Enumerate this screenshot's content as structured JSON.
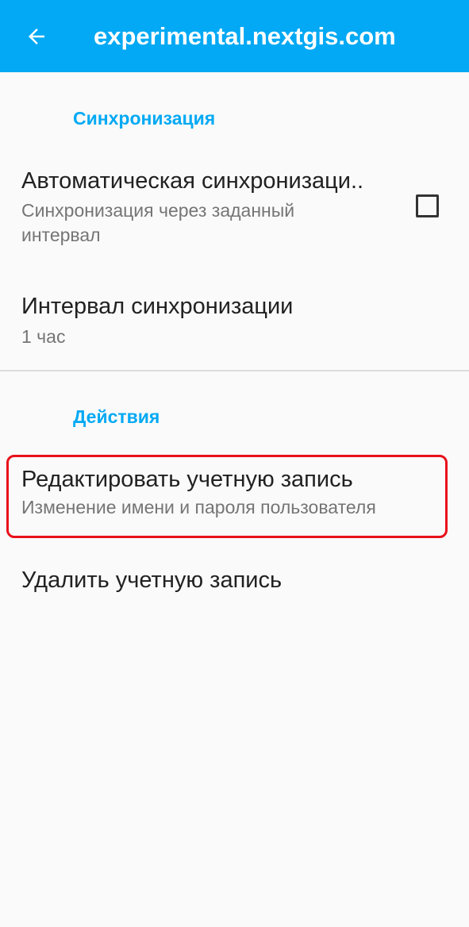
{
  "appbar": {
    "title": "experimental.nextgis.com",
    "back_icon": "arrow-back-icon",
    "background_color": "#03a9f4"
  },
  "sections": {
    "sync": {
      "header": "Синхронизация",
      "auto_sync": {
        "title": "Автоматическая синхронизаци..",
        "summary": "Синхронизация через заданный интервал",
        "checked": false
      },
      "interval": {
        "title": "Интервал синхронизации",
        "summary": "1 час"
      }
    },
    "actions": {
      "header": "Действия",
      "edit_account": {
        "title": "Редактировать учетную запись",
        "summary": "Изменение имени и пароля пользователя",
        "highlight_color": "#e8101a"
      },
      "delete_account": {
        "title": "Удалить учетную запись"
      }
    }
  },
  "colors": {
    "accent": "#03a9f4",
    "background": "#fafafa",
    "primary_text": "#212121",
    "secondary_text": "#757575"
  }
}
